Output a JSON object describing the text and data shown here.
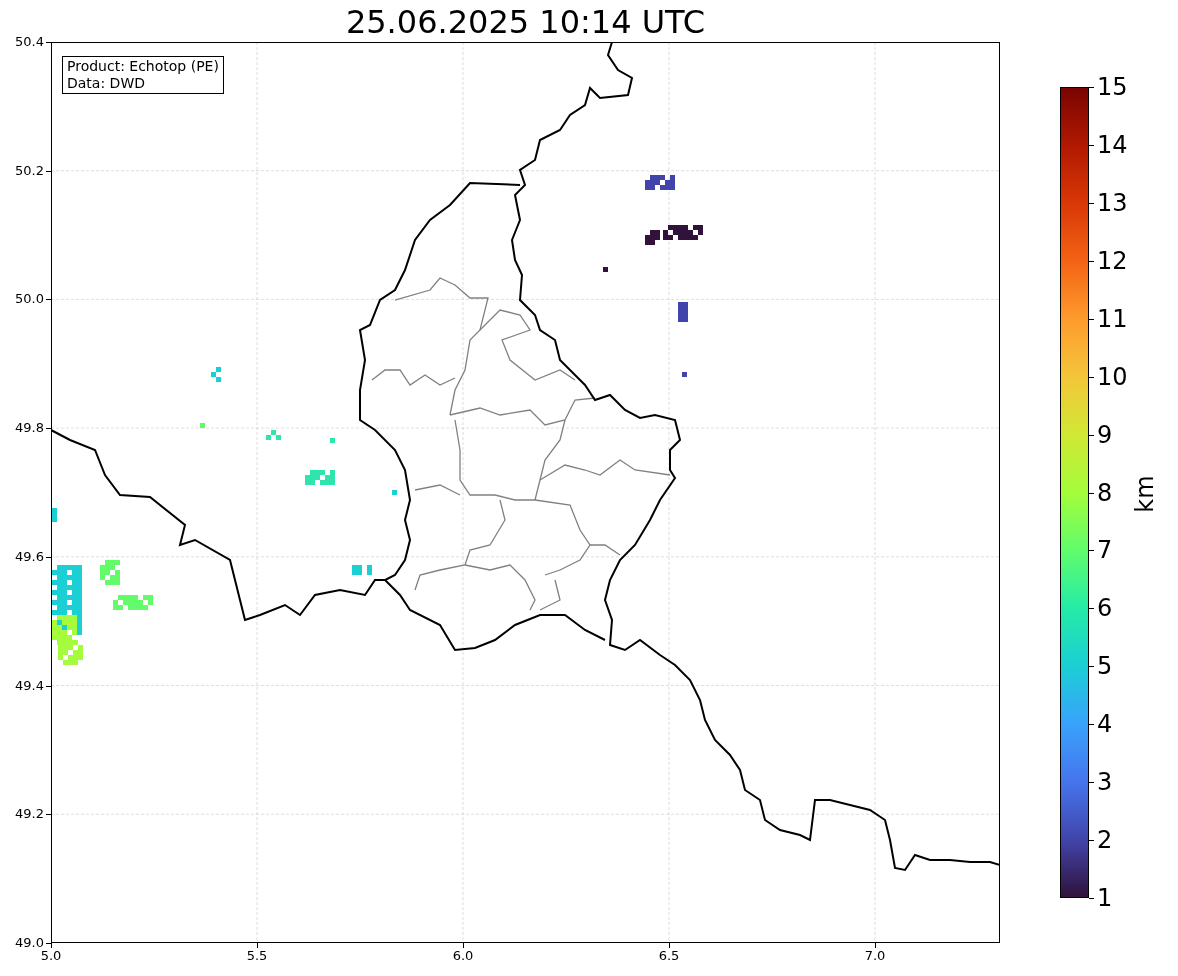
{
  "title": "25.06.2025 10:14 UTC",
  "info_box": [
    "Product: Echotop (PE)",
    "Data: DWD"
  ],
  "x_ticks": [
    "5.0",
    "5.5",
    "6.0",
    "6.5",
    "7.0"
  ],
  "y_ticks": [
    "50.4",
    "50.2",
    "50.0",
    "49.8",
    "49.6",
    "49.4",
    "49.2",
    "49.0"
  ],
  "colorbar": {
    "label": "km",
    "ticks": [
      "15",
      "14",
      "13",
      "12",
      "11",
      "10",
      "9",
      "8",
      "7",
      "6",
      "5",
      "4",
      "3",
      "2",
      "1"
    ]
  }
}
